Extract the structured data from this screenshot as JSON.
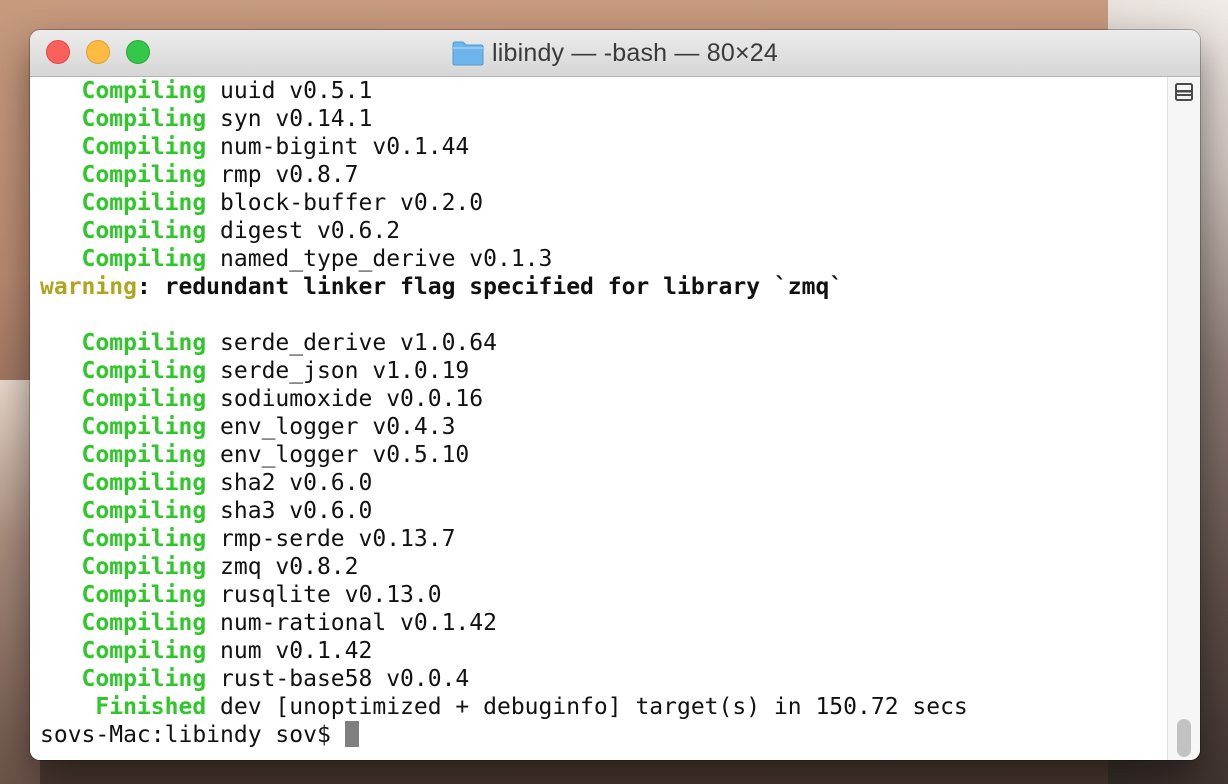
{
  "window": {
    "title": "libindy — -bash — 80×24",
    "title_icon": "folder-icon",
    "accent_colors": {
      "compiling": "#2fc72a",
      "warning": "#b0a51e",
      "close": "#fc605c",
      "minimize": "#fdbc40",
      "zoom": "#34c84a"
    }
  },
  "terminal": {
    "compile_lines": [
      {
        "verb": "Compiling",
        "pkg": "uuid v0.5.1"
      },
      {
        "verb": "Compiling",
        "pkg": "syn v0.14.1"
      },
      {
        "verb": "Compiling",
        "pkg": "num-bigint v0.1.44"
      },
      {
        "verb": "Compiling",
        "pkg": "rmp v0.8.7"
      },
      {
        "verb": "Compiling",
        "pkg": "block-buffer v0.2.0"
      },
      {
        "verb": "Compiling",
        "pkg": "digest v0.6.2"
      },
      {
        "verb": "Compiling",
        "pkg": "named_type_derive v0.1.3"
      }
    ],
    "warning": {
      "label": "warning",
      "message": ": redundant linker flag specified for library `zmq`"
    },
    "compile_lines_2": [
      {
        "verb": "Compiling",
        "pkg": "serde_derive v1.0.64"
      },
      {
        "verb": "Compiling",
        "pkg": "serde_json v1.0.19"
      },
      {
        "verb": "Compiling",
        "pkg": "sodiumoxide v0.0.16"
      },
      {
        "verb": "Compiling",
        "pkg": "env_logger v0.4.3"
      },
      {
        "verb": "Compiling",
        "pkg": "env_logger v0.5.10"
      },
      {
        "verb": "Compiling",
        "pkg": "sha2 v0.6.0"
      },
      {
        "verb": "Compiling",
        "pkg": "sha3 v0.6.0"
      },
      {
        "verb": "Compiling",
        "pkg": "rmp-serde v0.13.7"
      },
      {
        "verb": "Compiling",
        "pkg": "zmq v0.8.2"
      },
      {
        "verb": "Compiling",
        "pkg": "rusqlite v0.13.0"
      },
      {
        "verb": "Compiling",
        "pkg": "num-rational v0.1.42"
      },
      {
        "verb": "Compiling",
        "pkg": "num v0.1.42"
      },
      {
        "verb": "Compiling",
        "pkg": "rust-base58 v0.0.4"
      }
    ],
    "finished": {
      "verb": "Finished",
      "text": "dev [unoptimized + debuginfo] target(s) in 150.72 secs"
    },
    "prompt": "sovs-Mac:libindy sov$ "
  }
}
